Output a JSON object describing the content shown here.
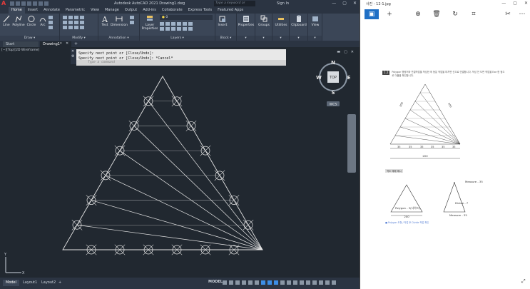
{
  "acad": {
    "logo": "A",
    "title": "Autodesk AutoCAD 2021    Drawing1.dwg",
    "search_placeholder": "Type a keyword or phrase",
    "signin": "Sign In",
    "ribbon_tabs": [
      "Home",
      "Insert",
      "Annotate",
      "Parametric",
      "View",
      "Manage",
      "Output",
      "Add-ins",
      "Collaborate",
      "Express Tools",
      "Featured Apps"
    ],
    "active_tab": "Home",
    "draw_tools": [
      "Line",
      "Polyline",
      "Circle",
      "Arc"
    ],
    "groups": {
      "draw": "Draw ▾",
      "modify": "Modify ▾",
      "annotation": "Annotation ▾",
      "layers": "Layers ▾",
      "block": "Block ▾"
    },
    "text_tool": "Text",
    "dimension_tool": "Dimension",
    "layer_props": "Layer Properties",
    "layer_value": "0",
    "insert_tool": "Insert",
    "right_tools": [
      "Properties",
      "Groups",
      "Utilities",
      "Clipboard",
      "View"
    ],
    "file_tabs": [
      "Start",
      "Drawing1*"
    ],
    "viewport_label": "[−][Top][2D Wireframe]",
    "cmd_history": [
      "Specify next point or [Close/Undo]:",
      "Specify next point or [Close/Undo]: *Cancel*"
    ],
    "cmd_placeholder": "Type a command",
    "viewcube": {
      "n": "N",
      "s": "S",
      "e": "E",
      "w": "W",
      "face": "TOP",
      "wcs": "WCS"
    },
    "ucs_y": "Y",
    "ucs_x": "X",
    "layout_tabs": [
      "Model",
      "Layout1",
      "Layout2",
      "+"
    ],
    "status_model": "MODEL"
  },
  "photos": {
    "title": "사진 - 12-1.jpg",
    "doc": {
      "number": "1.2",
      "header": "Polygon 명령어와 연결작업을 작성한 후 등분 작업을 마치면 선으로 연결합니다. 작성 전 도면 작업을 Exe 한 점으로 더블을 확인합니다.",
      "dims_top": [
        "200",
        "200"
      ],
      "dims_segments": [
        "35",
        "35",
        "35",
        "35",
        "35",
        "35"
      ],
      "dims_total": "200",
      "tag": "작도 예제 예시",
      "polygon_label": "Polygon - 3(사이드)",
      "polygon_dim": "200",
      "measure_1": "Measure - 35",
      "divide": "Divide - 7",
      "measure_2": "Measure - 35",
      "footnote": "■ Polygon 도형 / 작업 후 Divide 작업 확인"
    }
  }
}
